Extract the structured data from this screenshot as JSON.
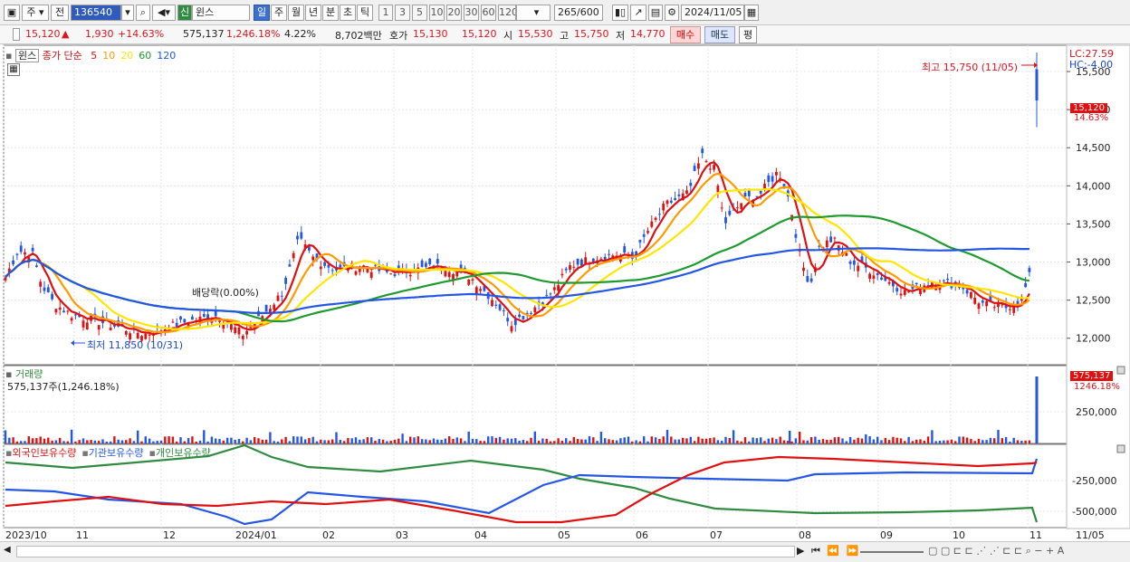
{
  "toolbar": {
    "market_label": "주",
    "prev_label": "전",
    "stock_code": "136540",
    "stock_badge": "신",
    "stock_name": "윈스",
    "period_tabs": [
      "일",
      "주",
      "월",
      "년",
      "분",
      "초",
      "틱"
    ],
    "interval_buttons": [
      "1",
      "3",
      "5",
      "10",
      "20",
      "30",
      "60",
      "120"
    ],
    "count_value": "265",
    "count_max": "/600",
    "date_value": "2024/11/05"
  },
  "quote": {
    "price": "15,120",
    "change": "1,930",
    "change_pct": "+14.63%",
    "volume": "575,137",
    "volume_pct": "1,246.18%",
    "turnover_pct": "4.22%",
    "amount": "8,702백만",
    "ask_label": "호가",
    "ask": "15,130",
    "bid": "15,120",
    "open_label": "시",
    "open": "15,530",
    "high_label": "고",
    "high": "15,750",
    "low_label": "저",
    "low": "14,770",
    "buy_button": "매수",
    "sell_button": "매도",
    "eval_button": "평"
  },
  "price_panel": {
    "stock_label": "윈스",
    "legend": {
      "prefix": "종가 단순",
      "ma": [
        "5",
        "10",
        "20",
        "60",
        "120"
      ]
    },
    "ma_colors": [
      "#e01010",
      "#ff9a00",
      "#ffe600",
      "#1e9a2f",
      "#2456e6"
    ],
    "lc": "LC:27.59",
    "hc": "HC:-4.00",
    "y_ticks": [
      "15,500",
      "15,000",
      "14,500",
      "14,000",
      "13,500",
      "13,000",
      "12,500",
      "12,000"
    ],
    "current_tag": "15,120",
    "current_pct": "14.63%",
    "high_note": "최고 15,750 (11/05)",
    "low_note": "최저 11,850 (10/31)",
    "dividend_note": "배당락(0.00%)"
  },
  "volume_panel": {
    "title": "거래량",
    "value": "575,137주(1,246.18%)",
    "tag": "575,137",
    "tag_pct": "1246.18%",
    "y_tick": "250,000"
  },
  "holding_panel": {
    "series": [
      "외국인보유수량",
      "기관보유수량",
      "개인보유수량"
    ],
    "series_colors": [
      "#e01010",
      "#2456e6",
      "#2e8b3f"
    ],
    "y_ticks": [
      "-250,000",
      "-500,000"
    ]
  },
  "x_axis": {
    "labels": [
      "2023/10",
      "11",
      "12",
      "2024/01",
      "02",
      "03",
      "04",
      "05",
      "06",
      "07",
      "08",
      "09",
      "10",
      "11",
      "11/05"
    ]
  }
}
